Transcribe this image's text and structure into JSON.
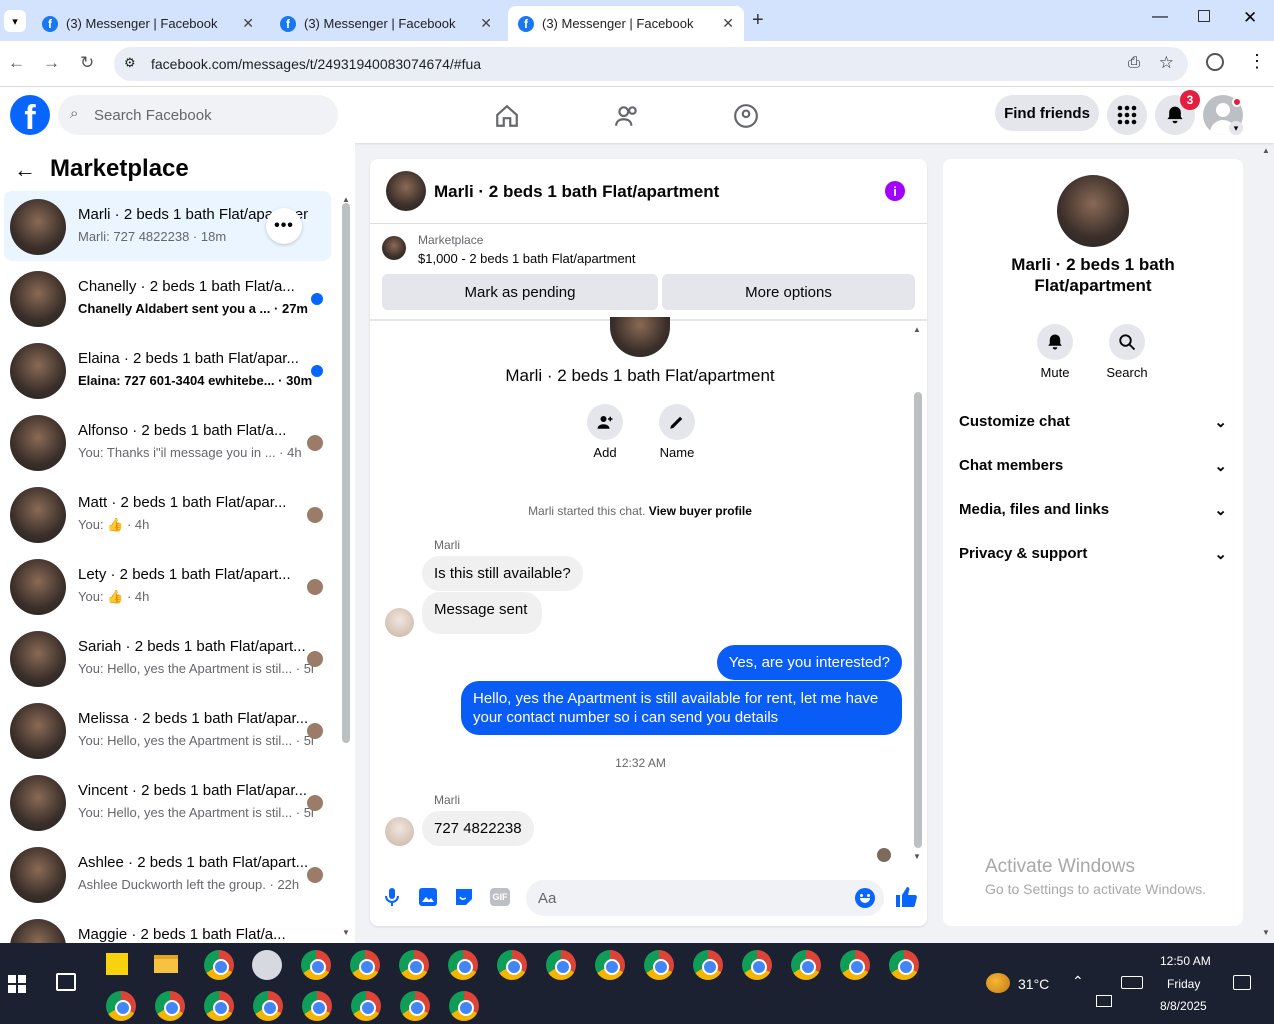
{
  "browser": {
    "tabs": [
      {
        "title": "(3) Messenger | Facebook",
        "active": false
      },
      {
        "title": "(3) Messenger | Facebook",
        "active": false
      },
      {
        "title": "(3) Messenger | Facebook",
        "active": true
      }
    ],
    "url": "facebook.com/messages/t/24931940083074674/#fua"
  },
  "header": {
    "search_placeholder": "Search Facebook",
    "find_friends": "Find friends",
    "notif_count": "3"
  },
  "left": {
    "title": "Marketplace",
    "conversations": [
      {
        "name": "Marli · 2 beds 1 bath Flat/apartment",
        "preview": "Marli: 727 4822238 · 18m",
        "selected": true,
        "unread": false
      },
      {
        "name": "Chanelly · 2 beds 1 bath Flat/a...",
        "preview": "Chanelly Aldabert sent you a ...",
        "time": "27m",
        "unread": true
      },
      {
        "name": "Elaina · 2 beds 1 bath Flat/apar...",
        "preview": "Elaina: 727 601-3404 ewhitebe...",
        "time": "30m",
        "unread": true
      },
      {
        "name": "Alfonso · 2 beds 1 bath Flat/a...",
        "preview": "You: Thanks i\"il message you in ...",
        "time": "4h",
        "unread": false
      },
      {
        "name": "Matt · 2 beds 1 bath Flat/apar...",
        "preview": "You: 👍",
        "time": "4h",
        "unread": false
      },
      {
        "name": "Lety · 2 beds 1 bath Flat/apart...",
        "preview": "You: 👍",
        "time": "4h",
        "unread": false
      },
      {
        "name": "Sariah · 2 beds 1 bath Flat/apart...",
        "preview": "You: Hello, yes the Apartment is stil...",
        "time": "5h",
        "unread": false
      },
      {
        "name": "Melissa · 2 beds 1 bath Flat/apar...",
        "preview": "You: Hello, yes the Apartment is stil...",
        "time": "5h",
        "unread": false
      },
      {
        "name": "Vincent · 2 beds 1 bath Flat/apar...",
        "preview": "You: Hello, yes the Apartment is stil...",
        "time": "5h",
        "unread": false
      },
      {
        "name": "Ashlee · 2 beds 1 bath Flat/apart...",
        "preview": "Ashlee Duckworth left the group.",
        "time": "22h",
        "unread": false
      },
      {
        "name": "Maggie · 2 beds 1 bath Flat/a...",
        "preview": "",
        "time": "",
        "unread": false
      }
    ]
  },
  "chat": {
    "title": "Marli · 2 beds 1 bath Flat/apartment",
    "listing_label": "Marketplace",
    "listing_price": "$1,000 - 2 beds 1 bath Flat/apartment",
    "mark_pending": "Mark as pending",
    "more_options": "More options",
    "profile_name": "Marli · 2 beds 1 bath Flat/apartment",
    "add_label": "Add",
    "name_label": "Name",
    "started_text": "Marli started this chat.",
    "view_buyer": "View buyer profile",
    "sender1": "Marli",
    "msg1": "Is this still available?",
    "msg2": "Message sent",
    "out1": "Yes, are you interested?",
    "out2": "Hello, yes the Apartment is still available for rent, let me have your contact number so i can send you details",
    "timestamp": "12:32 AM",
    "sender2": "Marli",
    "msg3": "727 4822238",
    "composer_placeholder": "Aa"
  },
  "right": {
    "name": "Marli · 2 beds 1 bath Flat/apartment",
    "mute": "Mute",
    "search": "Search",
    "sections": [
      "Customize chat",
      "Chat members",
      "Media, files and links",
      "Privacy & support"
    ],
    "activate_title": "Activate Windows",
    "activate_sub": "Go to Settings to activate Windows."
  },
  "taskbar": {
    "temp": "31°C",
    "time": "12:50 AM",
    "day": "Friday",
    "date": "8/8/2025"
  }
}
